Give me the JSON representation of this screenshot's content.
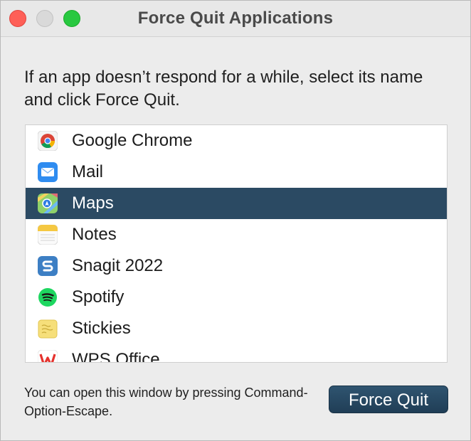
{
  "window": {
    "title": "Force Quit Applications"
  },
  "instructions": "If an app doesn’t respond for a while, select its name and click Force Quit.",
  "apps": [
    {
      "name": "Google Chrome",
      "icon": "chrome-icon",
      "selected": false
    },
    {
      "name": "Mail",
      "icon": "mail-icon",
      "selected": false
    },
    {
      "name": "Maps",
      "icon": "maps-icon",
      "selected": true
    },
    {
      "name": "Notes",
      "icon": "notes-icon",
      "selected": false
    },
    {
      "name": "Snagit 2022",
      "icon": "snagit-icon",
      "selected": false
    },
    {
      "name": "Spotify",
      "icon": "spotify-icon",
      "selected": false
    },
    {
      "name": "Stickies",
      "icon": "stickies-icon",
      "selected": false
    },
    {
      "name": "WPS Office",
      "icon": "wps-office-icon",
      "selected": false
    }
  ],
  "hint": "You can open this window by pressing Command-Option-Escape.",
  "button": {
    "force_quit_label": "Force Quit"
  },
  "colors": {
    "selection": "#2b4a63",
    "button": "#2a4a64",
    "close": "#fe5f57",
    "zoom": "#28c840"
  }
}
